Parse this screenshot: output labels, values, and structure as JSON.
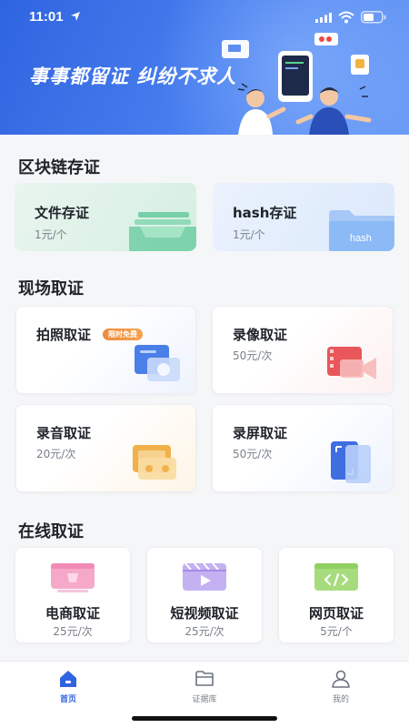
{
  "status_bar": {
    "time": "11:01"
  },
  "banner": {
    "slogan": "事事都留证  纠纷不求人"
  },
  "blockchain": {
    "title": "区块链存证",
    "cards": [
      {
        "label": "文件存证",
        "price": "1元/个"
      },
      {
        "label": "hash存证",
        "price": "1元/个",
        "folder_text": "hash"
      }
    ]
  },
  "onsite": {
    "title": "现场取证",
    "cards": [
      {
        "label": "拍照取证",
        "badge": "限时免费"
      },
      {
        "label": "录像取证",
        "price": "50元/次"
      },
      {
        "label": "录音取证",
        "price": "20元/次"
      },
      {
        "label": "录屏取证",
        "price": "50元/次"
      }
    ]
  },
  "online": {
    "title": "在线取证",
    "cards": [
      {
        "label": "电商取证",
        "price": "25元/次"
      },
      {
        "label": "短视频取证",
        "price": "25元/次"
      },
      {
        "label": "网页取证",
        "price": "5元/个"
      }
    ]
  },
  "tabbar": {
    "items": [
      {
        "label": "首页",
        "icon": "home-icon",
        "active": true
      },
      {
        "label": "证据库",
        "icon": "folder-icon",
        "active": false
      },
      {
        "label": "我的",
        "icon": "user-icon",
        "active": false
      }
    ]
  },
  "colors": {
    "accent": "#2f64e0",
    "badge": "#f08a3c"
  }
}
